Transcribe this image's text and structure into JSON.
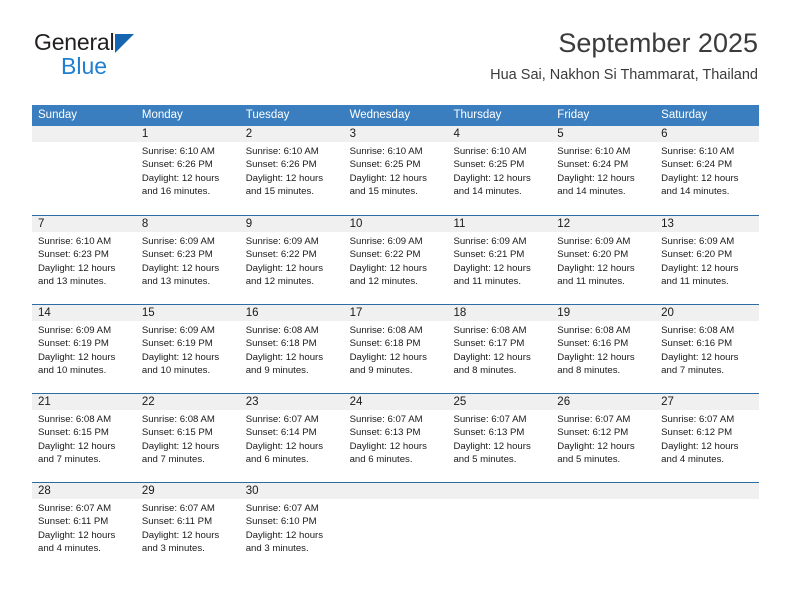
{
  "brand": {
    "word1": "General",
    "word2": "Blue",
    "triangle_color": "#1565b0",
    "blue_text_color": "#1f7fd0"
  },
  "header": {
    "title": "September 2025",
    "subtitle": "Hua Sai, Nakhon Si Thammarat, Thailand"
  },
  "calendar": {
    "header_bg": "#3a7ebf",
    "row_divider_color": "#2e6da4",
    "daynum_band_bg": "#f0f0f0",
    "weekdays": [
      "Sunday",
      "Monday",
      "Tuesday",
      "Wednesday",
      "Thursday",
      "Friday",
      "Saturday"
    ],
    "weeks": [
      [
        {
          "day": "",
          "lines": []
        },
        {
          "day": "1",
          "lines": [
            "Sunrise: 6:10 AM",
            "Sunset: 6:26 PM",
            "Daylight: 12 hours",
            "and 16 minutes."
          ]
        },
        {
          "day": "2",
          "lines": [
            "Sunrise: 6:10 AM",
            "Sunset: 6:26 PM",
            "Daylight: 12 hours",
            "and 15 minutes."
          ]
        },
        {
          "day": "3",
          "lines": [
            "Sunrise: 6:10 AM",
            "Sunset: 6:25 PM",
            "Daylight: 12 hours",
            "and 15 minutes."
          ]
        },
        {
          "day": "4",
          "lines": [
            "Sunrise: 6:10 AM",
            "Sunset: 6:25 PM",
            "Daylight: 12 hours",
            "and 14 minutes."
          ]
        },
        {
          "day": "5",
          "lines": [
            "Sunrise: 6:10 AM",
            "Sunset: 6:24 PM",
            "Daylight: 12 hours",
            "and 14 minutes."
          ]
        },
        {
          "day": "6",
          "lines": [
            "Sunrise: 6:10 AM",
            "Sunset: 6:24 PM",
            "Daylight: 12 hours",
            "and 14 minutes."
          ]
        }
      ],
      [
        {
          "day": "7",
          "lines": [
            "Sunrise: 6:10 AM",
            "Sunset: 6:23 PM",
            "Daylight: 12 hours",
            "and 13 minutes."
          ]
        },
        {
          "day": "8",
          "lines": [
            "Sunrise: 6:09 AM",
            "Sunset: 6:23 PM",
            "Daylight: 12 hours",
            "and 13 minutes."
          ]
        },
        {
          "day": "9",
          "lines": [
            "Sunrise: 6:09 AM",
            "Sunset: 6:22 PM",
            "Daylight: 12 hours",
            "and 12 minutes."
          ]
        },
        {
          "day": "10",
          "lines": [
            "Sunrise: 6:09 AM",
            "Sunset: 6:22 PM",
            "Daylight: 12 hours",
            "and 12 minutes."
          ]
        },
        {
          "day": "11",
          "lines": [
            "Sunrise: 6:09 AM",
            "Sunset: 6:21 PM",
            "Daylight: 12 hours",
            "and 11 minutes."
          ]
        },
        {
          "day": "12",
          "lines": [
            "Sunrise: 6:09 AM",
            "Sunset: 6:20 PM",
            "Daylight: 12 hours",
            "and 11 minutes."
          ]
        },
        {
          "day": "13",
          "lines": [
            "Sunrise: 6:09 AM",
            "Sunset: 6:20 PM",
            "Daylight: 12 hours",
            "and 11 minutes."
          ]
        }
      ],
      [
        {
          "day": "14",
          "lines": [
            "Sunrise: 6:09 AM",
            "Sunset: 6:19 PM",
            "Daylight: 12 hours",
            "and 10 minutes."
          ]
        },
        {
          "day": "15",
          "lines": [
            "Sunrise: 6:09 AM",
            "Sunset: 6:19 PM",
            "Daylight: 12 hours",
            "and 10 minutes."
          ]
        },
        {
          "day": "16",
          "lines": [
            "Sunrise: 6:08 AM",
            "Sunset: 6:18 PM",
            "Daylight: 12 hours",
            "and 9 minutes."
          ]
        },
        {
          "day": "17",
          "lines": [
            "Sunrise: 6:08 AM",
            "Sunset: 6:18 PM",
            "Daylight: 12 hours",
            "and 9 minutes."
          ]
        },
        {
          "day": "18",
          "lines": [
            "Sunrise: 6:08 AM",
            "Sunset: 6:17 PM",
            "Daylight: 12 hours",
            "and 8 minutes."
          ]
        },
        {
          "day": "19",
          "lines": [
            "Sunrise: 6:08 AM",
            "Sunset: 6:16 PM",
            "Daylight: 12 hours",
            "and 8 minutes."
          ]
        },
        {
          "day": "20",
          "lines": [
            "Sunrise: 6:08 AM",
            "Sunset: 6:16 PM",
            "Daylight: 12 hours",
            "and 7 minutes."
          ]
        }
      ],
      [
        {
          "day": "21",
          "lines": [
            "Sunrise: 6:08 AM",
            "Sunset: 6:15 PM",
            "Daylight: 12 hours",
            "and 7 minutes."
          ]
        },
        {
          "day": "22",
          "lines": [
            "Sunrise: 6:08 AM",
            "Sunset: 6:15 PM",
            "Daylight: 12 hours",
            "and 7 minutes."
          ]
        },
        {
          "day": "23",
          "lines": [
            "Sunrise: 6:07 AM",
            "Sunset: 6:14 PM",
            "Daylight: 12 hours",
            "and 6 minutes."
          ]
        },
        {
          "day": "24",
          "lines": [
            "Sunrise: 6:07 AM",
            "Sunset: 6:13 PM",
            "Daylight: 12 hours",
            "and 6 minutes."
          ]
        },
        {
          "day": "25",
          "lines": [
            "Sunrise: 6:07 AM",
            "Sunset: 6:13 PM",
            "Daylight: 12 hours",
            "and 5 minutes."
          ]
        },
        {
          "day": "26",
          "lines": [
            "Sunrise: 6:07 AM",
            "Sunset: 6:12 PM",
            "Daylight: 12 hours",
            "and 5 minutes."
          ]
        },
        {
          "day": "27",
          "lines": [
            "Sunrise: 6:07 AM",
            "Sunset: 6:12 PM",
            "Daylight: 12 hours",
            "and 4 minutes."
          ]
        }
      ],
      [
        {
          "day": "28",
          "lines": [
            "Sunrise: 6:07 AM",
            "Sunset: 6:11 PM",
            "Daylight: 12 hours",
            "and 4 minutes."
          ]
        },
        {
          "day": "29",
          "lines": [
            "Sunrise: 6:07 AM",
            "Sunset: 6:11 PM",
            "Daylight: 12 hours",
            "and 3 minutes."
          ]
        },
        {
          "day": "30",
          "lines": [
            "Sunrise: 6:07 AM",
            "Sunset: 6:10 PM",
            "Daylight: 12 hours",
            "and 3 minutes."
          ]
        },
        {
          "day": "",
          "lines": []
        },
        {
          "day": "",
          "lines": []
        },
        {
          "day": "",
          "lines": []
        },
        {
          "day": "",
          "lines": []
        }
      ]
    ]
  }
}
